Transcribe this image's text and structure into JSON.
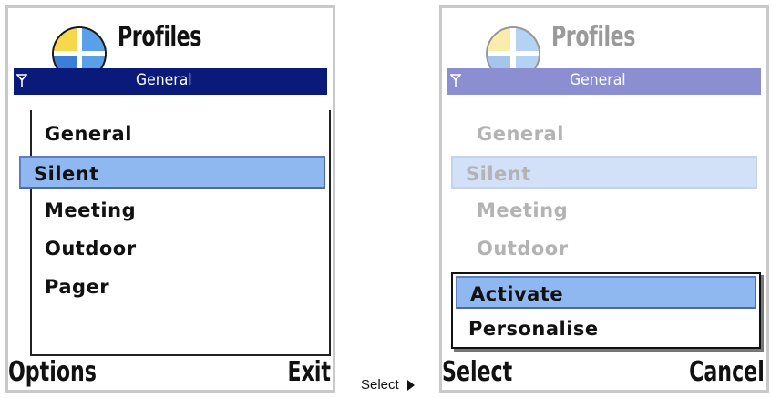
{
  "left_screen": {
    "title": "Profiles",
    "header_subtitle": "General",
    "items": [
      {
        "label": "General"
      },
      {
        "label": "Silent"
      },
      {
        "label": "Meeting"
      },
      {
        "label": "Outdoor"
      },
      {
        "label": "Pager"
      }
    ],
    "selected_item": "Silent",
    "softkeys": {
      "left": "Options",
      "right": "Exit"
    }
  },
  "transition": {
    "label": "Select",
    "icon": "right-triangle-icon"
  },
  "right_screen": {
    "title": "Profiles",
    "header_subtitle": "General",
    "items": [
      {
        "label": "General"
      },
      {
        "label": "Silent"
      },
      {
        "label": "Meeting"
      },
      {
        "label": "Outdoor"
      }
    ],
    "selected_item": "Silent",
    "popup_menu": [
      {
        "label": "Activate"
      },
      {
        "label": "Personalise"
      }
    ],
    "popup_selected": "Activate",
    "softkeys": {
      "left": "Select",
      "right": "Cancel"
    }
  },
  "colors": {
    "header_bar": "#0a1a7a",
    "selection": "#8fb7f0",
    "faded_header_bar": "#8c8ed2",
    "faded_selection": "#d3e1f8"
  },
  "icons": [
    "profiles-app-icon",
    "signal-strength-icon"
  ]
}
